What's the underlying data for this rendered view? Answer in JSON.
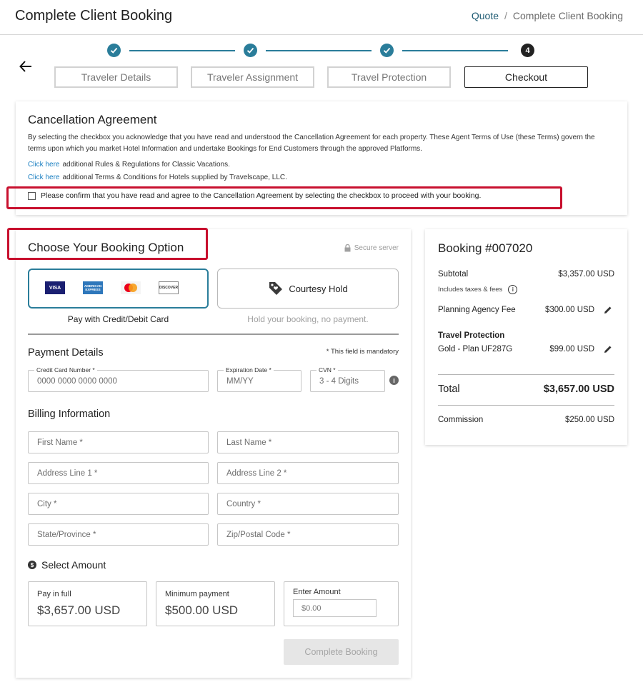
{
  "header": {
    "title": "Complete Client Booking",
    "breadcrumb": [
      "Quote",
      "Complete Client Booking"
    ],
    "breadcrumb_sep": "/"
  },
  "stepper": {
    "steps": [
      {
        "label": "Traveler Details",
        "state": "done"
      },
      {
        "label": "Traveler Assignment",
        "state": "done"
      },
      {
        "label": "Travel Protection",
        "state": "done"
      },
      {
        "label": "Checkout",
        "state": "current",
        "number": "4"
      }
    ]
  },
  "cancellation": {
    "title": "Cancellation Agreement",
    "text": "By selecting the checkbox you acknowledge that you have read and understood the Cancellation Agreement for each property. These Agent Terms of Use (these Terms) govern the terms upon which you market Hotel Information and undertake Bookings for End Customers through the approved Platforms.",
    "links": [
      {
        "link_text": "Click here",
        "rest": "additional Rules & Regulations for Classic Vacations."
      },
      {
        "link_text": "Click here",
        "rest": "additional Terms & Conditions for Hotels supplied by Travelscape, LLC."
      }
    ],
    "agree_label": "Please confirm that you have read and agree to the Cancellation Agreement by selecting the checkbox to proceed with your booking."
  },
  "booking": {
    "title": "Choose Your Booking Option",
    "secure_label": "Secure server",
    "card_logos": [
      "VISA",
      "AMERICAN EXPRESS",
      "",
      "DISCOVER"
    ],
    "option_card_caption": "Pay with Credit/Debit Card",
    "option_hold_label": "Courtesy Hold",
    "option_hold_caption": "Hold your booking, no payment.",
    "payment_title": "Payment Details",
    "mandatory_note": "* This field is mandatory",
    "card_number": {
      "label": "Credit Card Number  *",
      "placeholder": "0000 0000 0000 0000"
    },
    "expiration": {
      "label": "Expiration Date  *",
      "placeholder": "MM/YY"
    },
    "cvn": {
      "label": "CVN  *",
      "placeholder": "3 - 4 Digits"
    },
    "info_glyph": "i",
    "billing_title": "Billing Information",
    "billing_fields": [
      "First Name *",
      "Last Name *",
      "Address Line 1 *",
      "Address Line 2 *",
      "City *",
      "Country *",
      "State/Province *",
      "Zip/Postal Code *"
    ],
    "amount_title": "Select Amount",
    "amount_icon_glyph": "$",
    "amounts": [
      {
        "label": "Pay in full",
        "value": "$3,657.00 USD"
      },
      {
        "label": "Minimum payment",
        "value": "$500.00 USD"
      }
    ],
    "enter_amount_label": "Enter Amount",
    "enter_amount_placeholder": "$0.00",
    "complete_button": "Complete Booking"
  },
  "summary": {
    "title": "Booking #007020",
    "subtotal_label": "Subtotal",
    "subtotal_value": "$3,357.00 USD",
    "subtotal_note": "Includes taxes & fees",
    "agency_fee_label": "Planning Agency Fee",
    "agency_fee_value": "$300.00 USD",
    "protection_title": "Travel Protection",
    "protection_plan": "Gold - Plan UF287G",
    "protection_value": "$99.00 USD",
    "total_label": "Total",
    "total_value": "$3,657.00 USD",
    "commission_label": "Commission",
    "commission_value": "$250.00 USD"
  },
  "colors": {
    "accent": "#2a7d9a",
    "highlight": "#c8102e",
    "link": "#1a7fc1"
  }
}
